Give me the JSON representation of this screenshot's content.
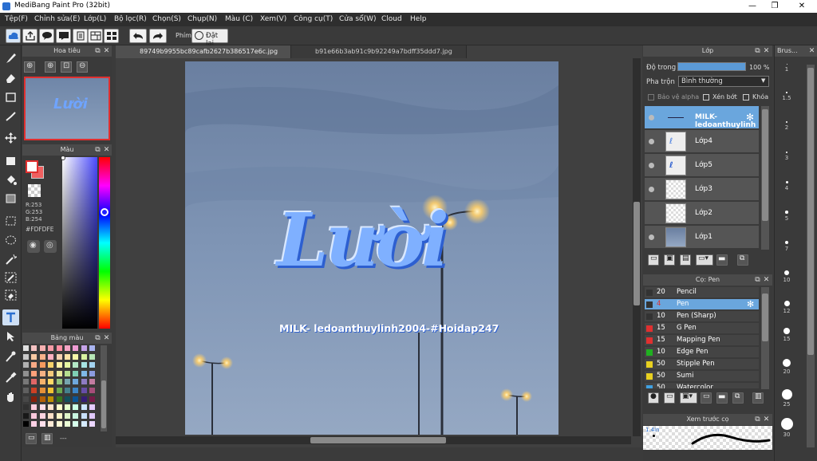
{
  "window": {
    "title": "MediBang Paint Pro (32bit)",
    "minimize": "—",
    "maximize": "❐",
    "close": "✕"
  },
  "menu": [
    "Tệp(F)",
    "Chỉnh sửa(E)",
    "Lớp(L)",
    "Bộ lọc(R)",
    "Chọn(S)",
    "Chụp(N)",
    "Màu (C)",
    "Xem(V)",
    "Công cụ(T)",
    "Cửa sổ(W)",
    "Cloud",
    "Help"
  ],
  "toolbar": {
    "key_label": "Phím",
    "reset_label": "Đặt lại"
  },
  "navigator": {
    "title": "Hoa tiêu"
  },
  "color": {
    "title": "Màu",
    "r": "R:253",
    "g": "G:253",
    "b": "B:254",
    "hex": "#FDFDFE"
  },
  "palette": {
    "title": "Bảng màu",
    "footer": "---",
    "colors": [
      "#e0e0e0",
      "#f4c2c2",
      "#f7b0b0",
      "#f59aa5",
      "#ff8fa3",
      "#f4a3c4",
      "#ef9cd4",
      "#c6a3e8",
      "#a9b4f0",
      "#c8c8c8",
      "#f9c9a3",
      "#f9b28a",
      "#ffb0c0",
      "#f7d1b1",
      "#fde3a7",
      "#f6f6a8",
      "#d8f2a0",
      "#b6e6b6",
      "#b0b0b0",
      "#f7a985",
      "#f49a5f",
      "#f7d26b",
      "#fff2a8",
      "#e6f7a3",
      "#b3e8c6",
      "#a8e4e3",
      "#a3d3f0",
      "#909090",
      "#ffa07a",
      "#f4b183",
      "#f4c97a",
      "#e9e79a",
      "#b5df8f",
      "#7fcfb5",
      "#7fb8e6",
      "#8b9be0",
      "#787878",
      "#e06666",
      "#f6b26b",
      "#ffd966",
      "#93c47d",
      "#76a5af",
      "#6fa8dc",
      "#8e7cc3",
      "#c27ba0",
      "#606060",
      "#cc4125",
      "#e69138",
      "#f1c232",
      "#6aa84f",
      "#45818e",
      "#3d85c6",
      "#674ea7",
      "#a64d79",
      "#484848",
      "#85200c",
      "#b45f06",
      "#bf9000",
      "#38761d",
      "#134f5c",
      "#0b5394",
      "#351c75",
      "#741b47",
      "#303030",
      "#ffccdd",
      "#ffdde8",
      "#ffe5cc",
      "#ffffcc",
      "#e5ffcc",
      "#ccffe5",
      "#cce5ff",
      "#e5ccff",
      "#181818",
      "#f8c8dc",
      "#fbd3e0",
      "#fde0c8",
      "#fdf5c8",
      "#dff5c8",
      "#c8f5e0",
      "#c8e0fb",
      "#e0c8fb",
      "#000000",
      "#ffd1e6",
      "#ffe0ec",
      "#ffebd6",
      "#fffad6",
      "#ebffd6",
      "#d6ffeb",
      "#d6ebff",
      "#ebd6ff"
    ]
  },
  "canvas": {
    "tabs": [
      "89749b9955bc89cafb2627b386517e6c.jpg",
      "b91e66b3ab91c9b92249a7bdff35ddd7.jpg"
    ],
    "art_title": "Lười",
    "art_caption": "MILK- ledoanthuylinh2004-#Hoidap247"
  },
  "layer_panel": {
    "title": "Lớp",
    "opacity_label": "Độ trong",
    "opacity_value": "100 %",
    "opacity_fraction": 1.0,
    "blend_label": "Pha trộn",
    "blend_value": "Bình thường",
    "protect_alpha": "Bảo vệ alpha",
    "clipping": "Xén bớt",
    "lock": "Khóa",
    "layers": [
      "MILK- ledoanthuylinh",
      "Lớp4",
      "Lớp5",
      "Lớp3",
      "Lớp2",
      "Lớp1"
    ]
  },
  "brush_panel": {
    "title": "Cọ: Pen",
    "brushes": [
      {
        "size": "20",
        "name": "Pencil",
        "color": "#333333"
      },
      {
        "size": "4",
        "name": "Pen",
        "color": "#333333"
      },
      {
        "size": "10",
        "name": "Pen (Sharp)",
        "color": "#333333"
      },
      {
        "size": "15",
        "name": "G Pen",
        "color": "#e03030"
      },
      {
        "size": "15",
        "name": "Mapping Pen",
        "color": "#e03030"
      },
      {
        "size": "10",
        "name": "Edge Pen",
        "color": "#20b020"
      },
      {
        "size": "50",
        "name": "Stipple Pen",
        "color": "#e8d020"
      },
      {
        "size": "50",
        "name": "Sumi",
        "color": "#e8d020"
      },
      {
        "size": "50",
        "name": "Watercolor",
        "color": "#40a0e0"
      }
    ]
  },
  "preview_panel": {
    "title": "Xem trước cọ",
    "size": "1.4in"
  },
  "brush_sizes": {
    "title": "Brus...",
    "values": [
      "1",
      "1.5",
      "2",
      "3",
      "4",
      "5",
      "7",
      "10",
      "12",
      "15",
      "20",
      "25",
      "30"
    ]
  }
}
